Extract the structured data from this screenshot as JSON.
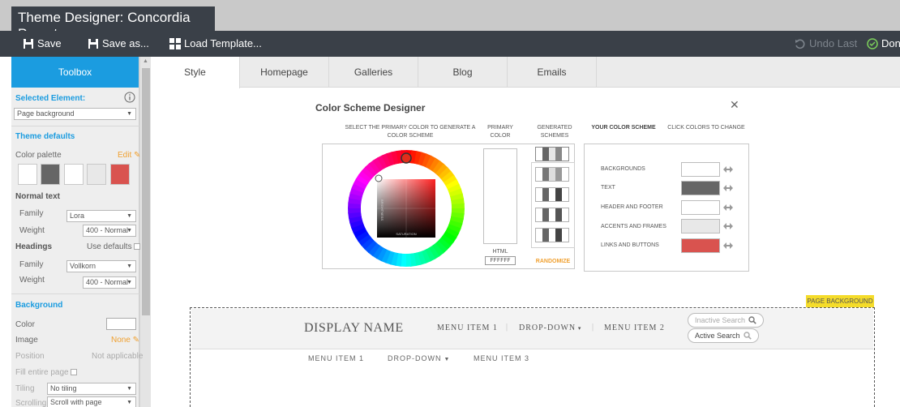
{
  "window": {
    "title": "Theme Designer: Concordia Preset"
  },
  "toolbar": {
    "save_label": "Save",
    "save_as_label": "Save as...",
    "load_template_label": "Load Template...",
    "undo_label": "Undo Last",
    "done_label": "Done"
  },
  "toolbox": {
    "header": "Toolbox",
    "selected_element_label": "Selected Element:",
    "selected_element_value": "Page background",
    "theme_defaults_label": "Theme defaults",
    "color_palette_label": "Color palette",
    "edit_label": "Edit",
    "palette_colors": [
      "#ffffff",
      "#666666",
      "#ffffff",
      "#e8e8e8",
      "#d9534f"
    ],
    "normal_text_label": "Normal text",
    "family_label": "Family",
    "weight_label": "Weight",
    "normal_family": "Lora",
    "normal_weight": "400 - Normal",
    "headings_label": "Headings",
    "use_defaults_label": "Use defaults",
    "headings_family": "Vollkorn",
    "headings_weight": "400 - Normal",
    "background_label": "Background",
    "color_label": "Color",
    "image_label": "Image",
    "image_value": "None",
    "position_label": "Position",
    "position_value": "Not applicable",
    "fill_label": "Fill entire page",
    "tiling_label": "Tiling",
    "tiling_value": "No tiling",
    "scrolling_label": "Scrolling",
    "scrolling_value": "Scroll with page"
  },
  "tabs": [
    "Style",
    "Homepage",
    "Galleries",
    "Blog",
    "Emails"
  ],
  "active_tab": "Style",
  "designer": {
    "title": "Color Scheme Designer",
    "hdr_select": "SELECT THE PRIMARY COLOR TO GENERATE A COLOR SCHEME",
    "hdr_primary": "PRIMARY COLOR",
    "hdr_generated": "GENERATED SCHEMES",
    "hdr_yours": "YOUR COLOR SCHEME",
    "hdr_click": "CLICK COLORS TO CHANGE",
    "brightness_label": "BRIGHTNESS",
    "saturation_label": "SATURATION",
    "html_label": "HTML",
    "html_value": "FFFFFF",
    "randomize_label": "RANDOMIZE",
    "scheme_rows": [
      {
        "label": "BACKGROUNDS",
        "color": "#ffffff"
      },
      {
        "label": "TEXT",
        "color": "#666666"
      },
      {
        "label": "HEADER AND FOOTER",
        "color": "#ffffff"
      },
      {
        "label": "ACCENTS AND FRAMES",
        "color": "#e8e8e8"
      },
      {
        "label": "LINKS AND BUTTONS",
        "color": "#d9534f"
      }
    ]
  },
  "preview": {
    "tag": "PAGE BACKGROUND",
    "display_name": "DISPLAY NAME",
    "menu_item_1": "MENU ITEM 1",
    "dropdown": "DROP-DOWN",
    "menu_item_2": "MENU ITEM 2",
    "inactive_search": "Inactive Search",
    "active_search": "Active Search",
    "sub_menu_item_1": "MENU ITEM 1",
    "sub_dropdown": "DROP-DOWN",
    "sub_menu_item_3": "MENU ITEM 3"
  },
  "colors": {
    "accent": "#1b9ce0",
    "toolbar": "#3a4048",
    "orange": "#f0a030",
    "tag": "#f5dc2a"
  }
}
